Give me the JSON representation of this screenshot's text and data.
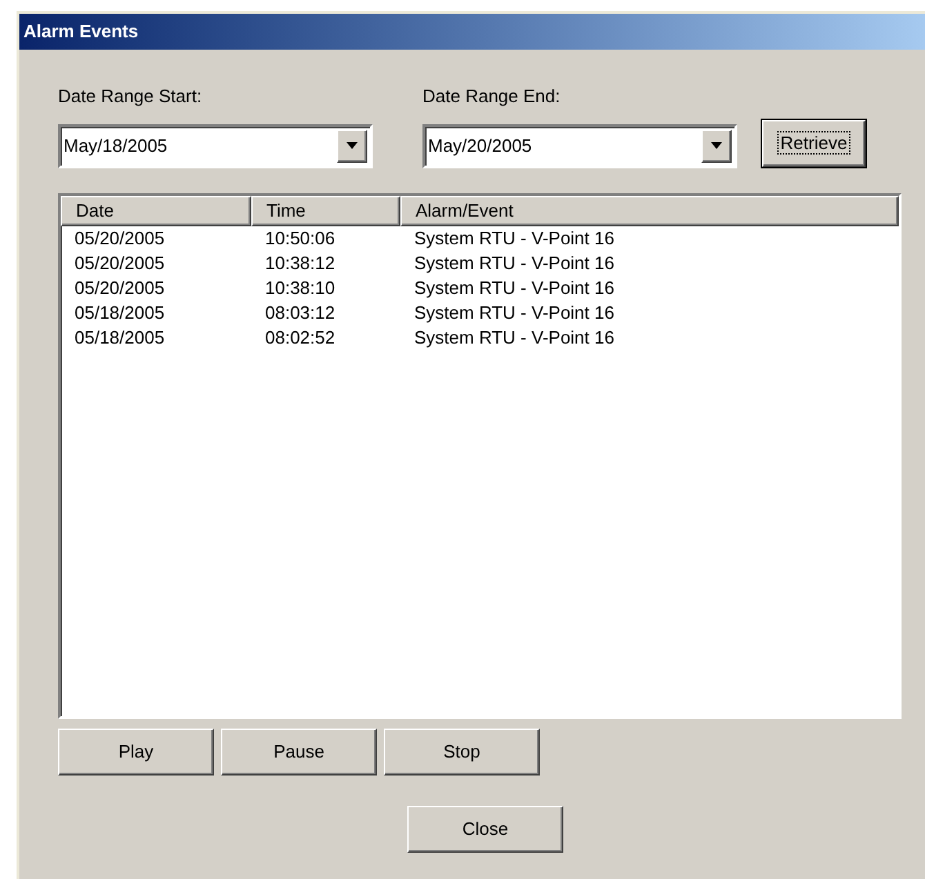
{
  "window": {
    "title": "Alarm Events"
  },
  "date_range_start": {
    "label": "Date Range Start:",
    "value": "May/18/2005"
  },
  "date_range_end": {
    "label": "Date Range End:",
    "value": "May/20/2005"
  },
  "retrieve_button": "Retrieve",
  "table": {
    "columns": [
      "Date",
      "Time",
      "Alarm/Event"
    ],
    "rows": [
      [
        "05/20/2005",
        "10:50:06",
        "System RTU - V-Point 16"
      ],
      [
        "05/20/2005",
        "10:38:12",
        "System RTU - V-Point 16"
      ],
      [
        "05/20/2005",
        "10:38:10",
        "System RTU - V-Point 16"
      ],
      [
        "05/18/2005",
        "08:03:12",
        "System RTU - V-Point 16"
      ],
      [
        "05/18/2005",
        "08:02:52",
        "System RTU - V-Point 16"
      ]
    ]
  },
  "playback_buttons": [
    "Play",
    "Pause",
    "Stop"
  ],
  "close_button": "Close"
}
